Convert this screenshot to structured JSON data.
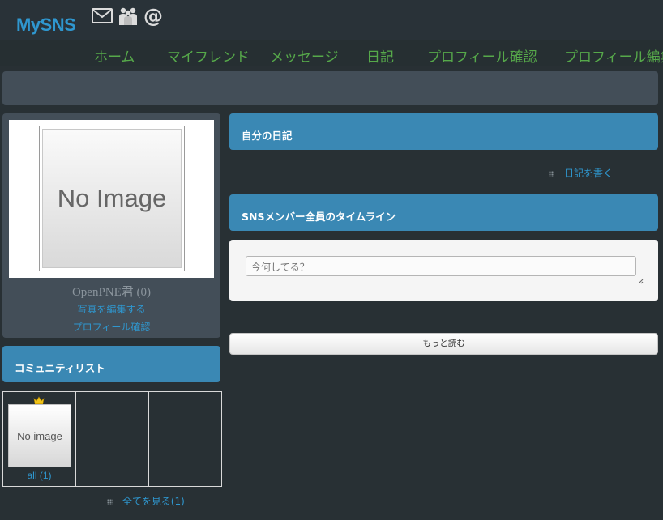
{
  "logo": "MySNS",
  "top_icons": [
    "mail-icon",
    "members-icon",
    "at-sign-icon"
  ],
  "nav": {
    "items": [
      "ホーム",
      "マイフレンド",
      "メッセージ",
      "日記",
      "プロフィール確認",
      "プロフィール編集"
    ]
  },
  "profile": {
    "photo_placeholder": "No Image",
    "name": "OpenPNE君 (0)",
    "edit_photo": "写真を編集する",
    "view_profile": "プロフィール確認"
  },
  "community": {
    "title": "コミュニティリスト",
    "items": [
      {
        "thumb_text": "No image",
        "label": "all (1)"
      }
    ],
    "see_all": "全てを見る(1)"
  },
  "diary": {
    "title": "自分の日記",
    "write": "日記を書く"
  },
  "timeline": {
    "title": "SNSメンバー全員のタイムライン",
    "placeholder": "今何してる？",
    "more": "もっと読む"
  },
  "colors": {
    "background": "#283034",
    "panel": "#434e58",
    "header_blue": "#3a88b4",
    "link": "#2f97cf",
    "nav_green": "#56a94a"
  }
}
